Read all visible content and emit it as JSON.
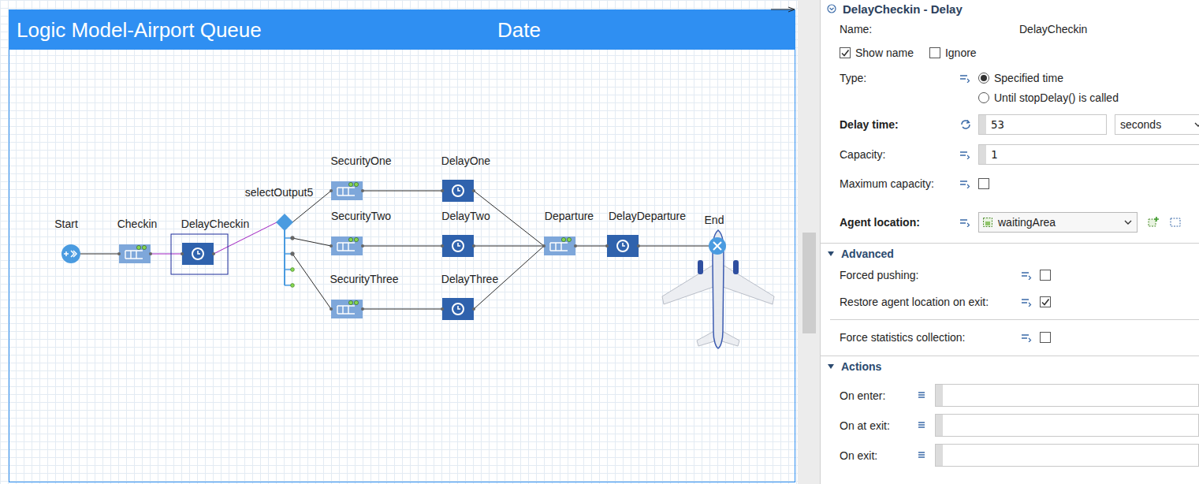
{
  "canvas": {
    "title": "Logic Model-Airport Queue",
    "date": "Date"
  },
  "diagram": {
    "nodes": [
      {
        "label": "Start",
        "kind": "source",
        "selected": false
      },
      {
        "label": "Checkin",
        "kind": "queue",
        "selected": false
      },
      {
        "label": "DelayCheckin",
        "kind": "delay",
        "selected": true
      },
      {
        "label": "selectOutput5",
        "kind": "select-output",
        "selected": false
      },
      {
        "label": "SecurityOne",
        "kind": "queue",
        "selected": false
      },
      {
        "label": "SecurityTwo",
        "kind": "queue",
        "selected": false
      },
      {
        "label": "SecurityThree",
        "kind": "queue",
        "selected": false
      },
      {
        "label": "DelayOne",
        "kind": "delay",
        "selected": false
      },
      {
        "label": "DelayTwo",
        "kind": "delay",
        "selected": false
      },
      {
        "label": "DelayThree",
        "kind": "delay",
        "selected": false
      },
      {
        "label": "Departure",
        "kind": "queue",
        "selected": false
      },
      {
        "label": "DelayDeparture",
        "kind": "delay",
        "selected": false
      },
      {
        "label": "End",
        "kind": "sink",
        "selected": false
      }
    ],
    "connections": [
      [
        "Start",
        "Checkin"
      ],
      [
        "Checkin",
        "DelayCheckin"
      ],
      [
        "DelayCheckin",
        "selectOutput5"
      ],
      [
        "selectOutput5",
        "SecurityOne"
      ],
      [
        "selectOutput5",
        "SecurityTwo"
      ],
      [
        "selectOutput5",
        "SecurityThree"
      ],
      [
        "SecurityOne",
        "DelayOne"
      ],
      [
        "SecurityTwo",
        "DelayTwo"
      ],
      [
        "SecurityThree",
        "DelayThree"
      ],
      [
        "DelayOne",
        "Departure"
      ],
      [
        "DelayTwo",
        "Departure"
      ],
      [
        "DelayThree",
        "Departure"
      ],
      [
        "Departure",
        "DelayDeparture"
      ],
      [
        "DelayDeparture",
        "End"
      ]
    ]
  },
  "properties": {
    "title": "DelayCheckin - Delay",
    "name": {
      "label": "Name:",
      "value": "DelayCheckin"
    },
    "show_name": {
      "label": "Show name",
      "checked": true
    },
    "ignore": {
      "label": "Ignore",
      "checked": false
    },
    "type": {
      "label": "Type:",
      "options": [
        {
          "label": "Specified time",
          "selected": true
        },
        {
          "label": "Until stopDelay() is called",
          "selected": false
        }
      ]
    },
    "delay_time": {
      "label": "Delay time:",
      "value": "53",
      "unit": "seconds"
    },
    "capacity": {
      "label": "Capacity:",
      "value": "1"
    },
    "maximum_capacity": {
      "label": "Maximum capacity:",
      "checked": false
    },
    "agent_location": {
      "label": "Agent location:",
      "value": "waitingArea"
    },
    "advanced": {
      "title": "Advanced",
      "expanded": true,
      "groups": [
        [
          {
            "label": "Forced pushing:",
            "checked": false
          },
          {
            "label": "Restore agent location on exit:",
            "checked": true
          }
        ],
        [
          {
            "label": "Force statistics collection:",
            "checked": false
          }
        ]
      ]
    },
    "actions": {
      "title": "Actions",
      "expanded": true,
      "fields": [
        {
          "label": "On enter:",
          "value": ""
        },
        {
          "label": "On at exit:",
          "value": ""
        },
        {
          "label": "On exit:",
          "value": ""
        }
      ]
    }
  }
}
